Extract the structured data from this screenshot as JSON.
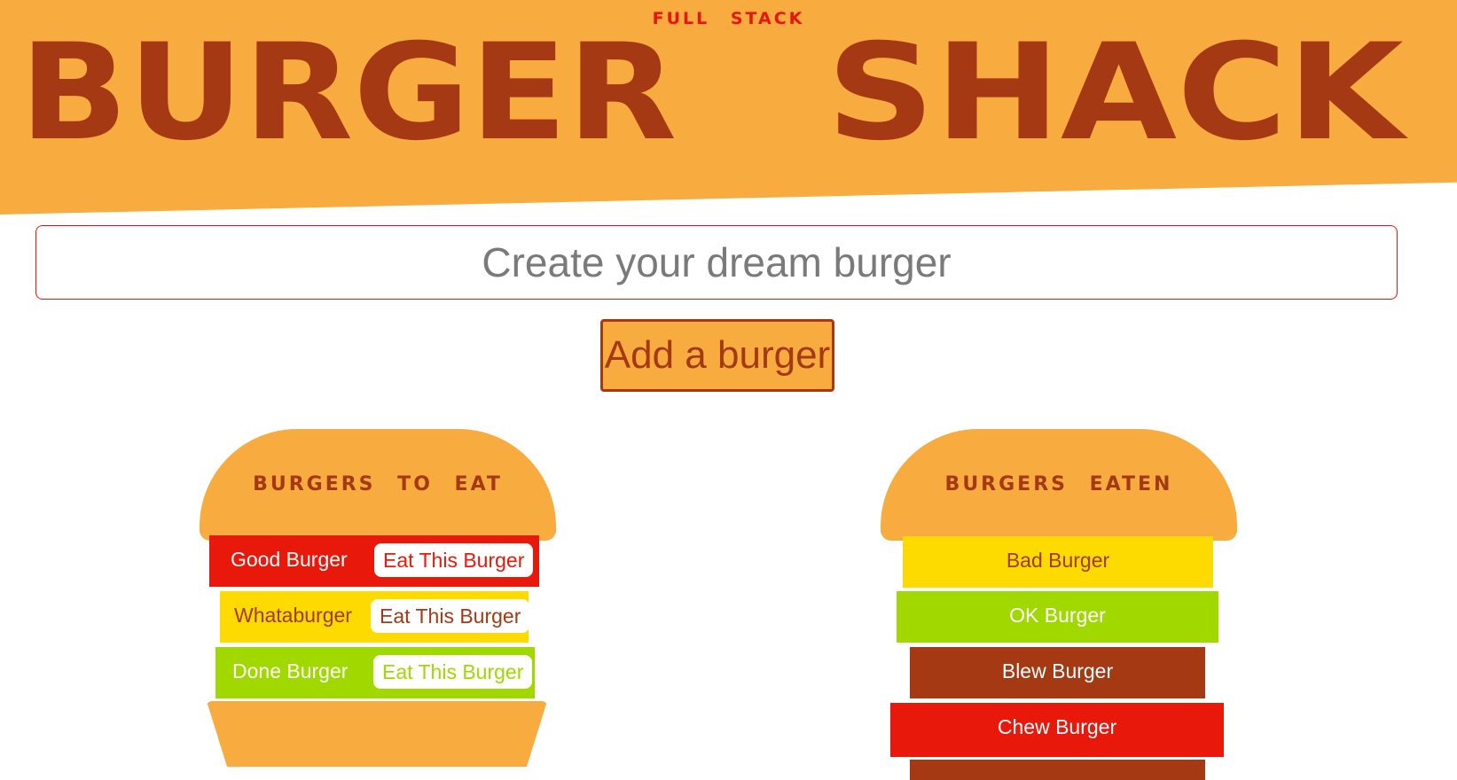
{
  "header": {
    "kicker": "FULL STACK",
    "title_left": "BURGER",
    "title_right": "SHACK"
  },
  "form": {
    "input_placeholder": "Create your dream burger",
    "input_value": "",
    "submit_label": "Add a burger"
  },
  "to_eat": {
    "title": "BURGERS TO EAT",
    "items": [
      {
        "name": "Good Burger",
        "button": "Eat This Burger",
        "color": "#e8190a",
        "text_color": "#ffffff"
      },
      {
        "name": "Whataburger",
        "button": "Eat This Burger",
        "color": "#fddb00",
        "text_color": "#a43914"
      },
      {
        "name": "Done Burger",
        "button": "Eat This Burger",
        "color": "#a0d800",
        "text_color": "#ffffff"
      }
    ]
  },
  "eaten": {
    "title": "BURGERS EATEN",
    "items": [
      {
        "name": "Bad Burger",
        "color": "#fddb00",
        "text_color": "#a43914"
      },
      {
        "name": "OK Burger",
        "color": "#a0d800",
        "text_color": "#ffffff"
      },
      {
        "name": "Blew Burger",
        "color": "#a43914",
        "text_color": "#ffffff"
      },
      {
        "name": "Chew Burger",
        "color": "#e8190a",
        "text_color": "#ffffff"
      }
    ]
  },
  "colors": {
    "bun": "#f8ab3f",
    "brand_brown": "#a43914",
    "accent_red": "#e8150a"
  }
}
